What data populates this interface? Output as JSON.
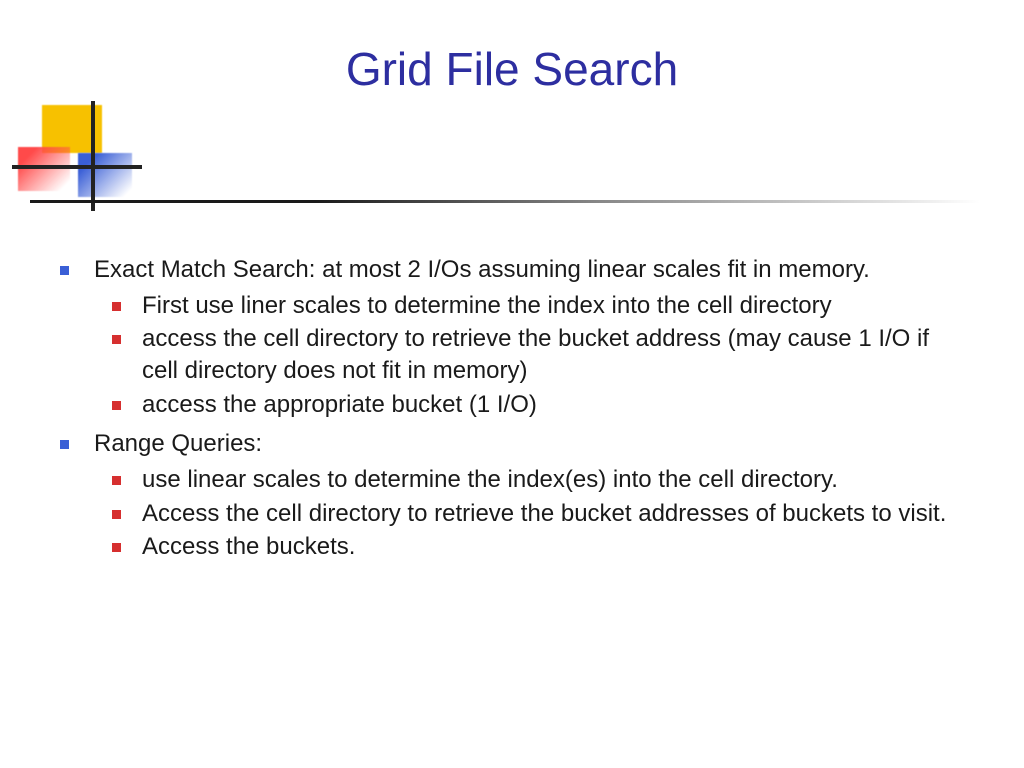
{
  "title": "Grid File Search",
  "bullets": [
    {
      "text": "Exact Match Search: at most 2 I/Os assuming linear scales fit in memory.",
      "sub": [
        "First use liner scales to determine the index into the cell directory",
        "access the cell directory to retrieve the bucket address (may cause 1 I/O if cell directory does not fit in memory)",
        "access the appropriate bucket (1 I/O)"
      ]
    },
    {
      "text": "Range Queries:",
      "sub": [
        "use linear scales to determine the index(es) into the cell directory.",
        "Access the cell directory to retrieve the bucket addresses of buckets to visit.",
        "Access the buckets."
      ]
    }
  ]
}
